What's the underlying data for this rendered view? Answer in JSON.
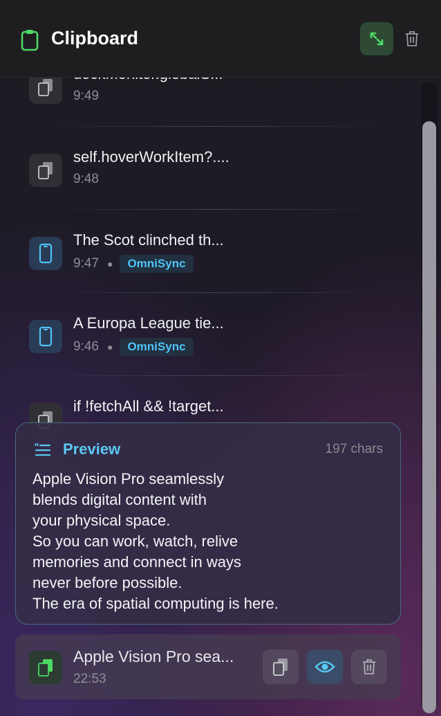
{
  "header": {
    "title": "Clipboard",
    "app_icon": "clipboard-icon",
    "expand_icon": "expand-arrows-icon",
    "trash_icon": "trash-icon",
    "accent_color": "#4cd964"
  },
  "history": [
    {
      "label": "dockMonitor.globalS...",
      "time": "9:49",
      "icon": "copy-docs-icon",
      "source": ""
    },
    {
      "label": "self.hoverWorkItem?....",
      "time": "9:48",
      "icon": "copy-docs-icon",
      "source": ""
    },
    {
      "label": "The Scot clinched th...",
      "time": "9:47",
      "icon": "phone-icon",
      "source": "OmniSync"
    },
    {
      "label": "A Europa League tie...",
      "time": "9:46",
      "icon": "phone-icon",
      "source": "OmniSync"
    },
    {
      "label": "if !fetchAll && !target...",
      "time": "",
      "icon": "copy-docs-icon",
      "source": ""
    }
  ],
  "preview": {
    "title": "Preview",
    "char_count": "197 chars",
    "text": "Apple Vision Pro seamlessly\nblends digital content with\nyour physical space.\nSo you can work, watch, relive\nmemories and connect in ways\nnever before possible.\nThe era of spatial computing is here."
  },
  "selected_item": {
    "label": "Apple Vision Pro sea...",
    "time": "22:53",
    "icon": "copy-docs-green-icon",
    "actions": [
      "copy-icon",
      "eye-icon",
      "trash-icon"
    ]
  },
  "colors": {
    "source_badge_text": "#4fc3f7",
    "preview_title": "#5ac8f0",
    "preview_border": "#4a6a80"
  }
}
